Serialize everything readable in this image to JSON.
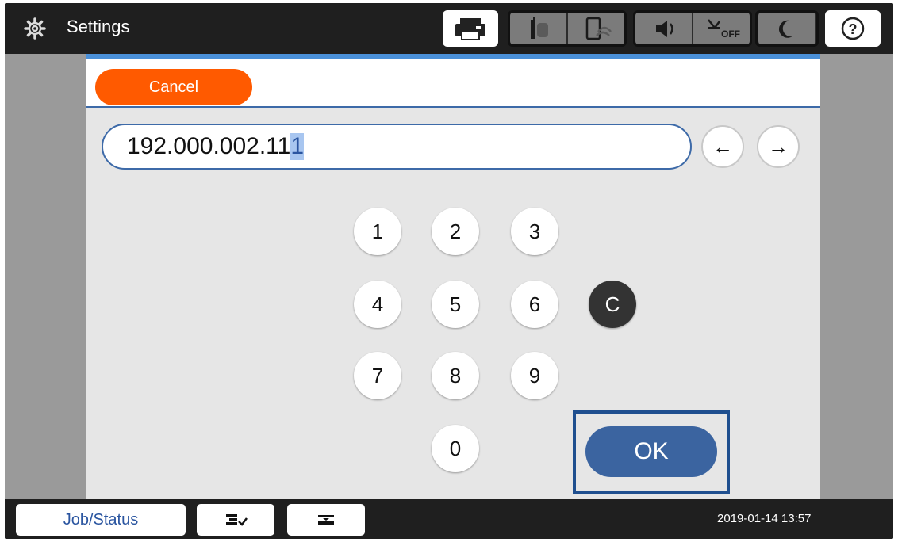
{
  "header": {
    "title": "Settings",
    "title_icon": "gear-icon",
    "status_icons": [
      "printer-icon",
      "wired-lan-icon",
      "wifi-icon",
      "speaker-icon",
      "eco-off-icon",
      "sleep-moon-icon",
      "help-icon"
    ]
  },
  "panel": {
    "cancel_label": "Cancel",
    "ip_value_main": "192.000.002.11",
    "ip_value_cursor": "1",
    "nav": {
      "left_label": "←",
      "right_label": "→"
    },
    "keypad": {
      "k1": "1",
      "k2": "2",
      "k3": "3",
      "k4": "4",
      "k5": "5",
      "k6": "6",
      "k7": "7",
      "k8": "8",
      "k9": "9",
      "k0": "0",
      "clear": "C"
    },
    "ok_label": "OK"
  },
  "footer": {
    "job_status_label": "Job/Status",
    "icons": [
      "job-list-icon",
      "paper-tray-icon"
    ],
    "datetime": "2019-01-14 13:57"
  },
  "colors": {
    "cancel": "#ff5a00",
    "ok": "#3b64a0",
    "accent": "#4a90d9",
    "highlight_frame": "#1f4f8f"
  }
}
